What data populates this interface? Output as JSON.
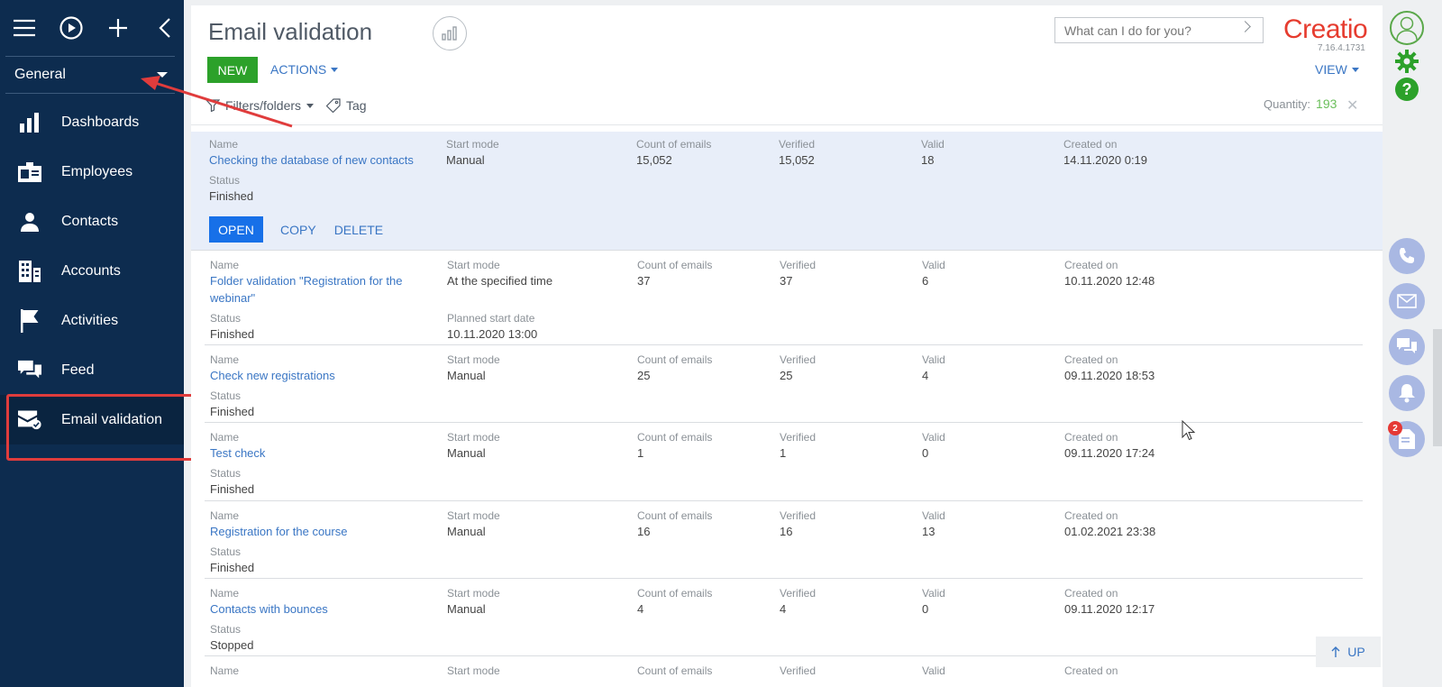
{
  "sidebar": {
    "workplace": "General",
    "items": [
      {
        "label": "Dashboards",
        "icon": "bar-chart-icon"
      },
      {
        "label": "Employees",
        "icon": "id-card-icon"
      },
      {
        "label": "Contacts",
        "icon": "person-icon"
      },
      {
        "label": "Accounts",
        "icon": "building-icon"
      },
      {
        "label": "Activities",
        "icon": "flag-icon"
      },
      {
        "label": "Feed",
        "icon": "chat-bubbles-icon"
      },
      {
        "label": "Email validation",
        "icon": "email-check-icon"
      }
    ]
  },
  "header": {
    "title": "Email validation",
    "search_placeholder": "What can I do for you?",
    "logo": "Creatio",
    "version": "7.16.4.1731",
    "new_label": "NEW",
    "actions_label": "ACTIONS",
    "view_label": "VIEW",
    "filters_label": "Filters/folders",
    "tag_label": "Tag",
    "quantity_label": "Quantity:",
    "quantity_value": "193"
  },
  "columns": {
    "name": "Name",
    "start_mode": "Start mode",
    "count": "Count of emails",
    "verified": "Verified",
    "valid": "Valid",
    "created": "Created on",
    "status": "Status",
    "planned": "Planned start date"
  },
  "row_actions": {
    "open": "OPEN",
    "copy": "COPY",
    "delete": "DELETE"
  },
  "rows": [
    {
      "name": "Checking the database of new contacts",
      "start_mode": "Manual",
      "count": "15,052",
      "verified": "15,052",
      "valid": "18",
      "created": "14.11.2020 0:19",
      "status": "Finished"
    },
    {
      "name_line1": "Folder validation \"Registration for the",
      "name_line2": "webinar\"",
      "start_mode": "At the specified time",
      "count": "37",
      "verified": "37",
      "valid": "6",
      "created": "10.11.2020 12:48",
      "status": "Finished",
      "planned": "10.11.2020 13:00"
    },
    {
      "name": "Check new registrations",
      "start_mode": "Manual",
      "count": "25",
      "verified": "25",
      "valid": "4",
      "created": "09.11.2020 18:53",
      "status": "Finished"
    },
    {
      "name": "Test check",
      "start_mode": "Manual",
      "count": "1",
      "verified": "1",
      "valid": "0",
      "created": "09.11.2020 17:24",
      "status": "Finished"
    },
    {
      "name": "Registration for the course",
      "start_mode": "Manual",
      "count": "16",
      "verified": "16",
      "valid": "13",
      "created": "01.02.2021 23:38",
      "status": "Finished"
    },
    {
      "name": "Contacts with bounces",
      "start_mode": "Manual",
      "count": "4",
      "verified": "4",
      "valid": "0",
      "created": "09.11.2020 12:17",
      "status": "Stopped"
    }
  ],
  "up_label": "UP",
  "notification_count": "2",
  "colors": {
    "sidebar": "#0d2c4f",
    "accent": "#2ca12a",
    "link": "#3a76c4",
    "selected_row": "#e8eef9",
    "highlight": "#e03c3c"
  }
}
